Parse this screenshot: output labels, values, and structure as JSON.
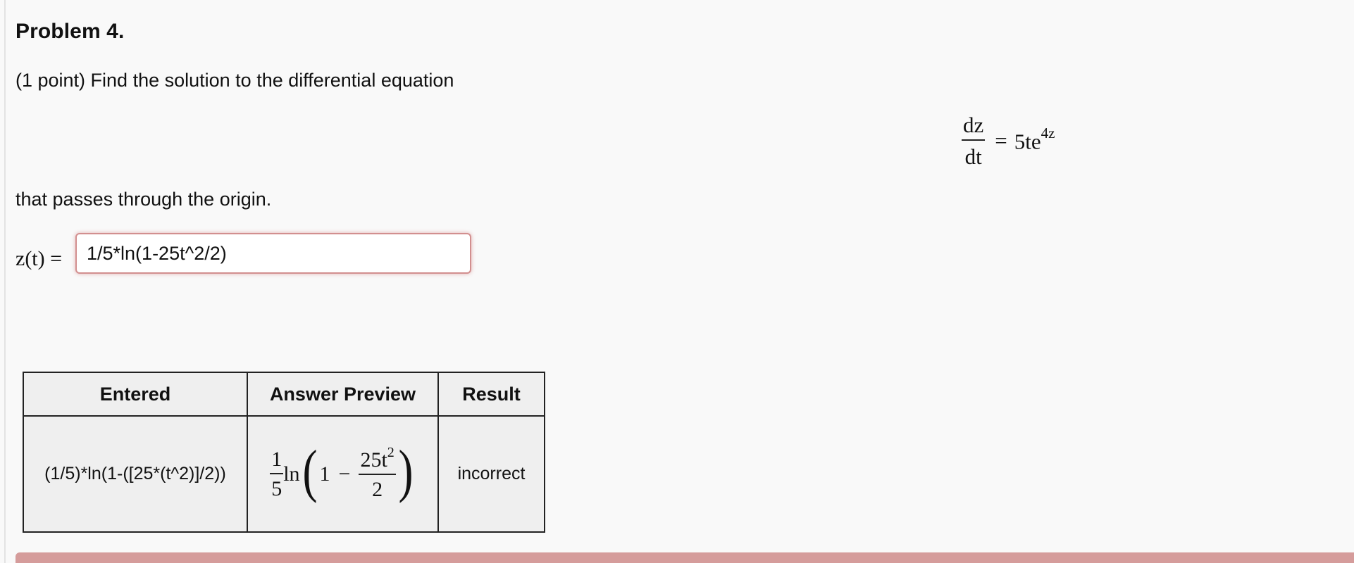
{
  "problem": {
    "title": "Problem 4.",
    "prompt": "(1 point) Find the solution to the differential equation",
    "equation": {
      "lhs_numerator": "dz",
      "lhs_denominator": "dt",
      "equals": "=",
      "rhs_base": "5te",
      "rhs_exponent": "4z"
    },
    "condition": "that passes through the origin."
  },
  "answer": {
    "label": "z(t) =",
    "value": "1/5*ln(1-25t^2/2)"
  },
  "results": {
    "headers": {
      "entered": "Entered",
      "preview": "Answer Preview",
      "result": "Result"
    },
    "row": {
      "entered": "(1/5)*ln(1-([25*(t^2)]/2))",
      "preview": {
        "coef_numerator": "1",
        "coef_denominator": "5",
        "func": "ln",
        "open_paren": "(",
        "one": "1",
        "minus": "−",
        "inner_numerator_base": "25t",
        "inner_numerator_exp": "2",
        "inner_denominator": "2",
        "close_paren": ")"
      },
      "result": "incorrect"
    }
  },
  "colors": {
    "input_border": "#d28f8f",
    "table_background": "#efefef",
    "status_bar": "#d59c9b",
    "page_background": "#f9f9f9"
  }
}
